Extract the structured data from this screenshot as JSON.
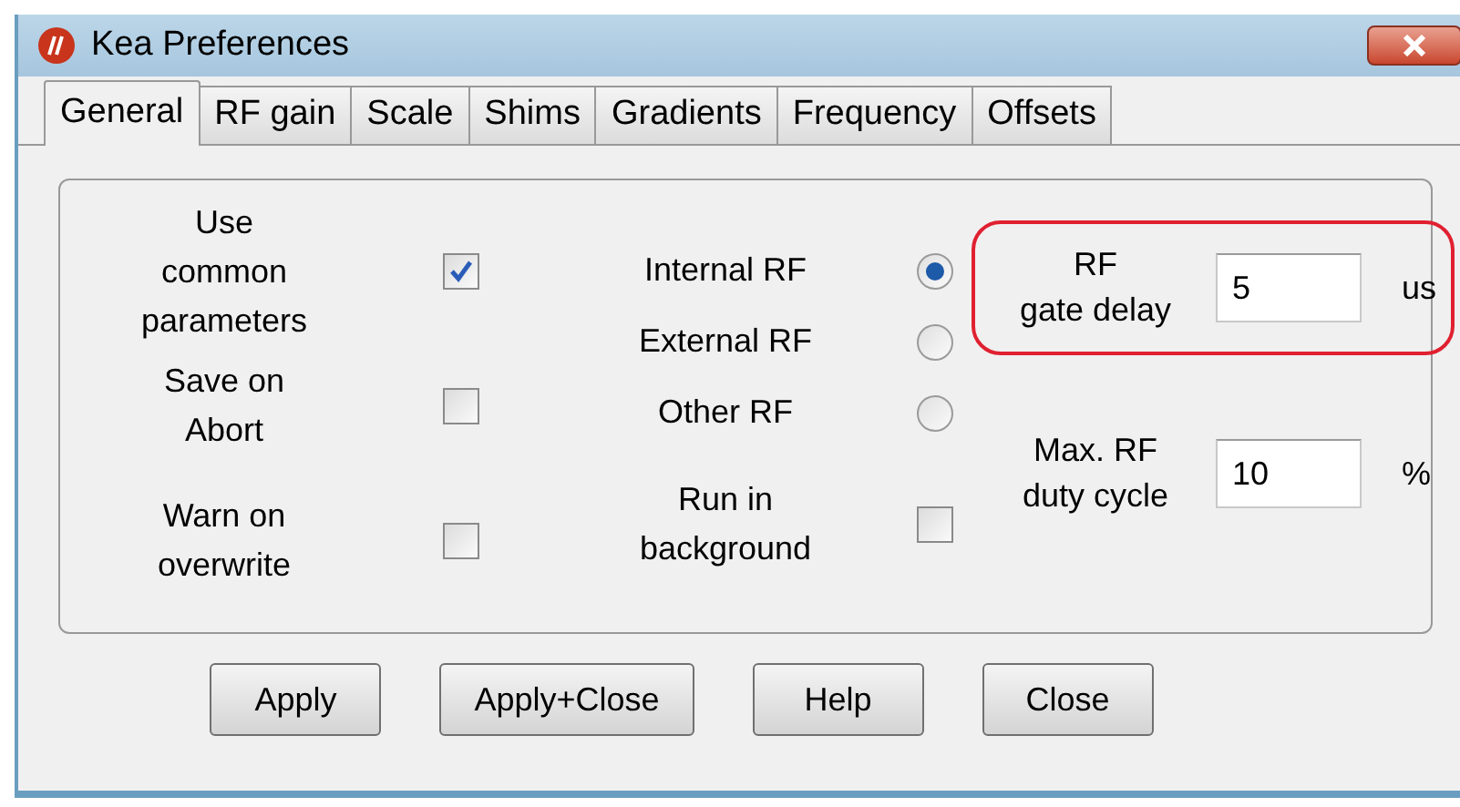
{
  "window": {
    "title": "Kea Preferences"
  },
  "tabs": [
    {
      "label": "General",
      "selected": true
    },
    {
      "label": "RF gain",
      "selected": false
    },
    {
      "label": "Scale",
      "selected": false
    },
    {
      "label": "Shims",
      "selected": false
    },
    {
      "label": "Gradients",
      "selected": false
    },
    {
      "label": "Frequency",
      "selected": false
    },
    {
      "label": "Offsets",
      "selected": false
    }
  ],
  "options": [
    {
      "label": "Use common parameters",
      "checked": true
    },
    {
      "label": "Save on Abort",
      "checked": false
    },
    {
      "label": "Warn on overwrite",
      "checked": false
    }
  ],
  "rf_source": [
    {
      "label": "Internal RF",
      "selected": true
    },
    {
      "label": "External RF",
      "selected": false
    },
    {
      "label": "Other RF",
      "selected": false
    }
  ],
  "background_option": {
    "label": "Run in background",
    "checked": false
  },
  "fields": [
    {
      "label_lines": [
        "RF",
        "gate delay"
      ],
      "value": "5",
      "unit": "us",
      "highlighted": true
    },
    {
      "label_lines": [
        "Max. RF",
        "duty cycle"
      ],
      "value": "10",
      "unit": "%",
      "highlighted": false
    }
  ],
  "buttons": [
    "Apply",
    "Apply+Close",
    "Help",
    "Close"
  ]
}
